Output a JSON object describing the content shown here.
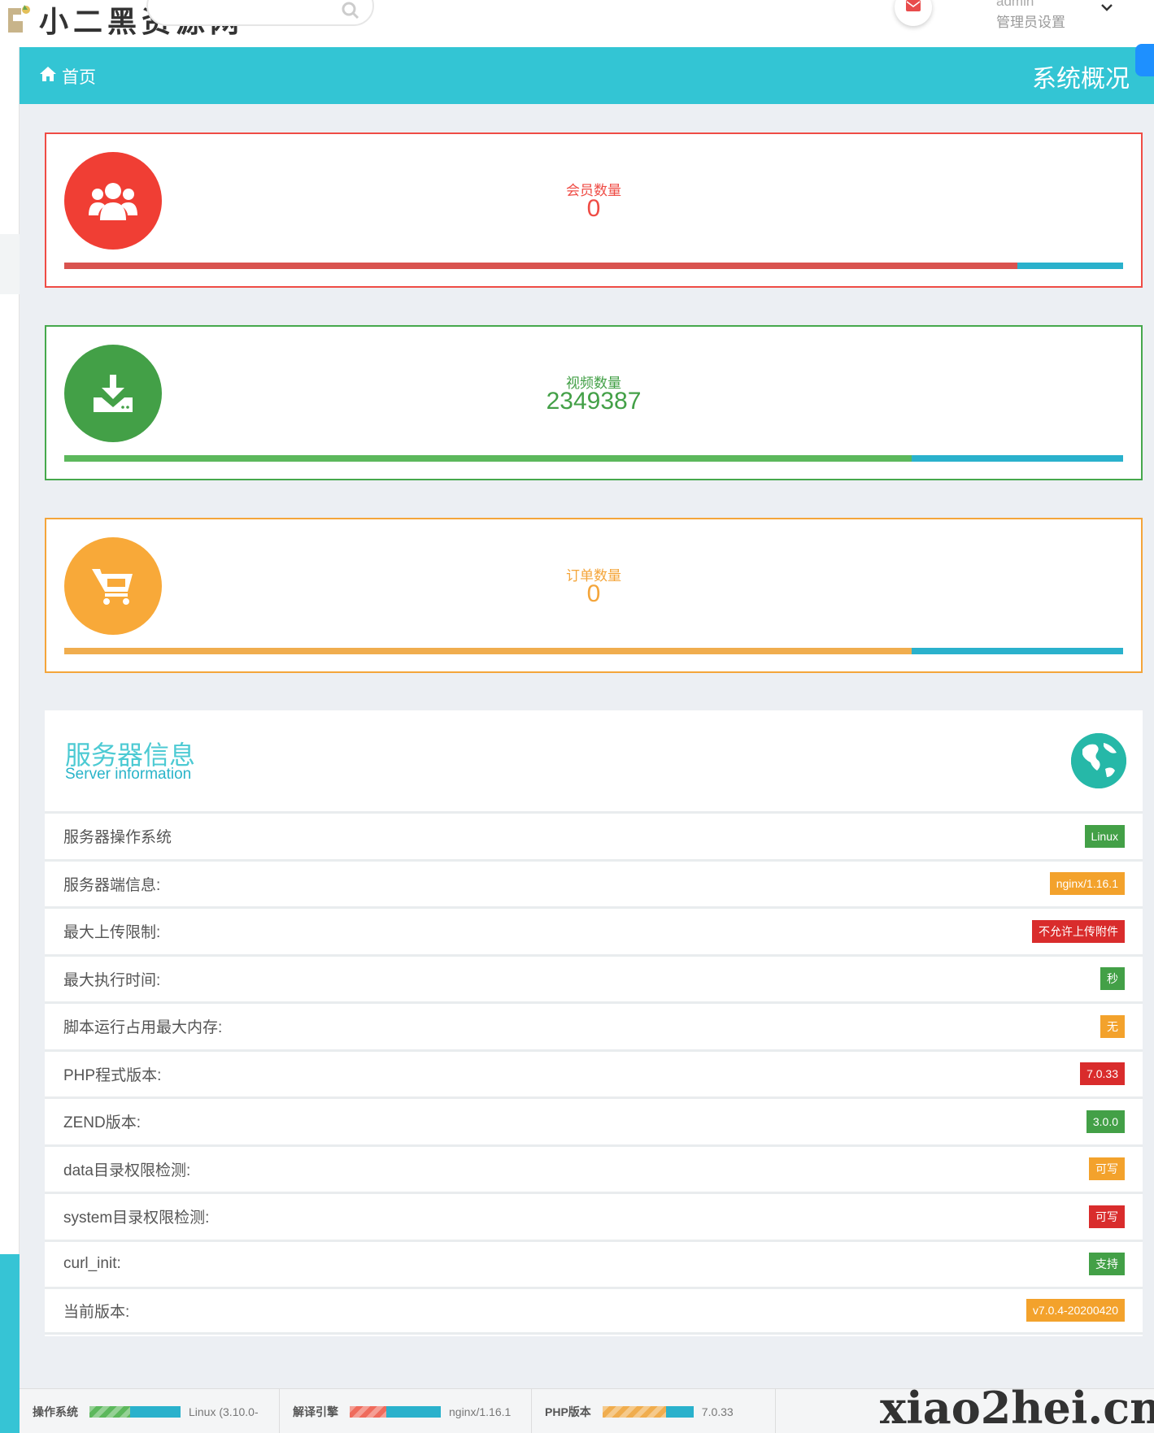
{
  "header": {
    "logo_text": "小二黑资源网",
    "admin_name": "admin",
    "admin_settings": "管理员设置"
  },
  "titlebar": {
    "home_label": "首页",
    "page_title": "系统概况"
  },
  "stats": [
    {
      "label": "会员数量",
      "value": "0",
      "icon": "users-icon",
      "fill_fraction": 0.9,
      "color": "#ef4c45"
    },
    {
      "label": "视频数量",
      "value": "2349387",
      "icon": "download-icon",
      "fill_fraction": 0.8,
      "color": "#43a047"
    },
    {
      "label": "订单数量",
      "value": "0",
      "icon": "cart-icon",
      "fill_fraction": 0.8,
      "color": "#f4a53a"
    }
  ],
  "server": {
    "title": "服务器信息",
    "subtitle": "Server information",
    "rows": [
      {
        "label": "服务器操作系统",
        "value": "Linux",
        "color": "green"
      },
      {
        "label": "服务器端信息:",
        "value": "nginx/1.16.1",
        "color": "orange"
      },
      {
        "label": "最大上传限制:",
        "value": "不允许上传附件",
        "color": "red"
      },
      {
        "label": "最大执行时间:",
        "value": "秒",
        "color": "green"
      },
      {
        "label": "脚本运行占用最大内存:",
        "value": "无",
        "color": "orange"
      },
      {
        "label": "PHP程式版本:",
        "value": "7.0.33",
        "color": "red"
      },
      {
        "label": "ZEND版本:",
        "value": "3.0.0",
        "color": "green"
      },
      {
        "label": "data目录权限检测:",
        "value": "可写",
        "color": "orange"
      },
      {
        "label": "system目录权限检测:",
        "value": "可写",
        "color": "red"
      },
      {
        "label": "curl_init:",
        "value": "支持",
        "color": "green"
      },
      {
        "label": "当前版本:",
        "value": "v7.0.4-20200420",
        "color": "orange"
      }
    ]
  },
  "footer": {
    "items": [
      {
        "label": "操作系统",
        "value": "Linux (3.10.0-",
        "fill_fraction": 0.45,
        "color": "#5cb85c"
      },
      {
        "label": "解译引擎",
        "value": "nginx/1.16.1",
        "fill_fraction": 0.4,
        "color": "#ef6b5c"
      },
      {
        "label": "PHP版本",
        "value": "7.0.33",
        "fill_fraction": 0.7,
        "color": "#f0ad4e"
      }
    ],
    "watermark": "xiao2hei.cn"
  }
}
